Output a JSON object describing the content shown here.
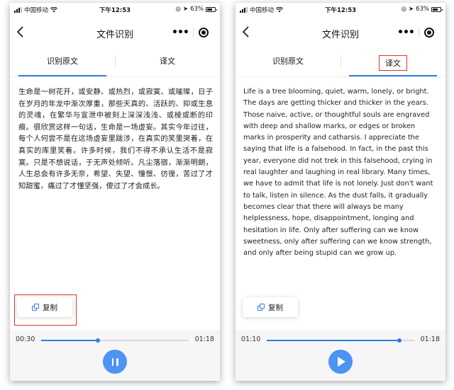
{
  "status_bar": {
    "carrier": "中国移动",
    "time": "下午12:53",
    "battery": "63%"
  },
  "nav": {
    "title": "文件识别"
  },
  "tabs": [
    {
      "label": "识别原文"
    },
    {
      "label": "译文"
    }
  ],
  "left_panel": {
    "active_tab": 0,
    "text": "生命是一树花开，或安静、或热烈，或寂寞、或璀璨，日子在岁月的年龙中渐次厚重，那些天真的、活跃的、抑或生息的灵魂，在繁华与宣泄中被刻上深深浅浅、或棱或断的印痕。很欣赏这样一句话，生命是一场虚妄。其实今年过往，每个人何尝不是在这场虚妄里跋涉，在真实的笑里哭着，在真实的库里笑着。许多时候，我们不得不承认生活不是寂寞。只是不想说话，于无声处倾听。凡尘落宿，渐渐明朗，人生总会有许多无奈，希望、失望、憧憬、彷徨，苦过了才知甜蜜，痛过了才懂坚强，傻过了才会成长。",
    "copy_label": "复制",
    "current_time": "00:30",
    "total_time": "01:18",
    "progress": 0.385,
    "playing": true
  },
  "right_panel": {
    "active_tab": 1,
    "text": "Life is a tree blooming, quiet, warm, lonely, or bright. The days are getting thicker and thicker in the years. Those naive, active, or thoughtful souls are engraved with deep and shallow marks, or edges or broken marks in prosperity and catharsis. I appreciate the saying that life is a falsehood. In fact, in the past this year, everyone did not trek in this falsehood, crying in real laughter and laughing in real library. Many times, we have to admit that life is not lonely. Just don't want to talk, listen in silence. As the dust falls, it gradually becomes clear that there will always be many helplessness, hope, disappointment, longing and hesitation in life. Only after suffering can we know sweetness, only after suffering can we know strength, and only after being stupid can we grow up.",
    "copy_label": "复制",
    "current_time": "01:10",
    "total_time": "01:18",
    "progress": 0.897,
    "playing": false
  },
  "colors": {
    "accent": "#2f7de6",
    "play_button": "#4c93f2",
    "highlight_box": "#e0332d"
  }
}
